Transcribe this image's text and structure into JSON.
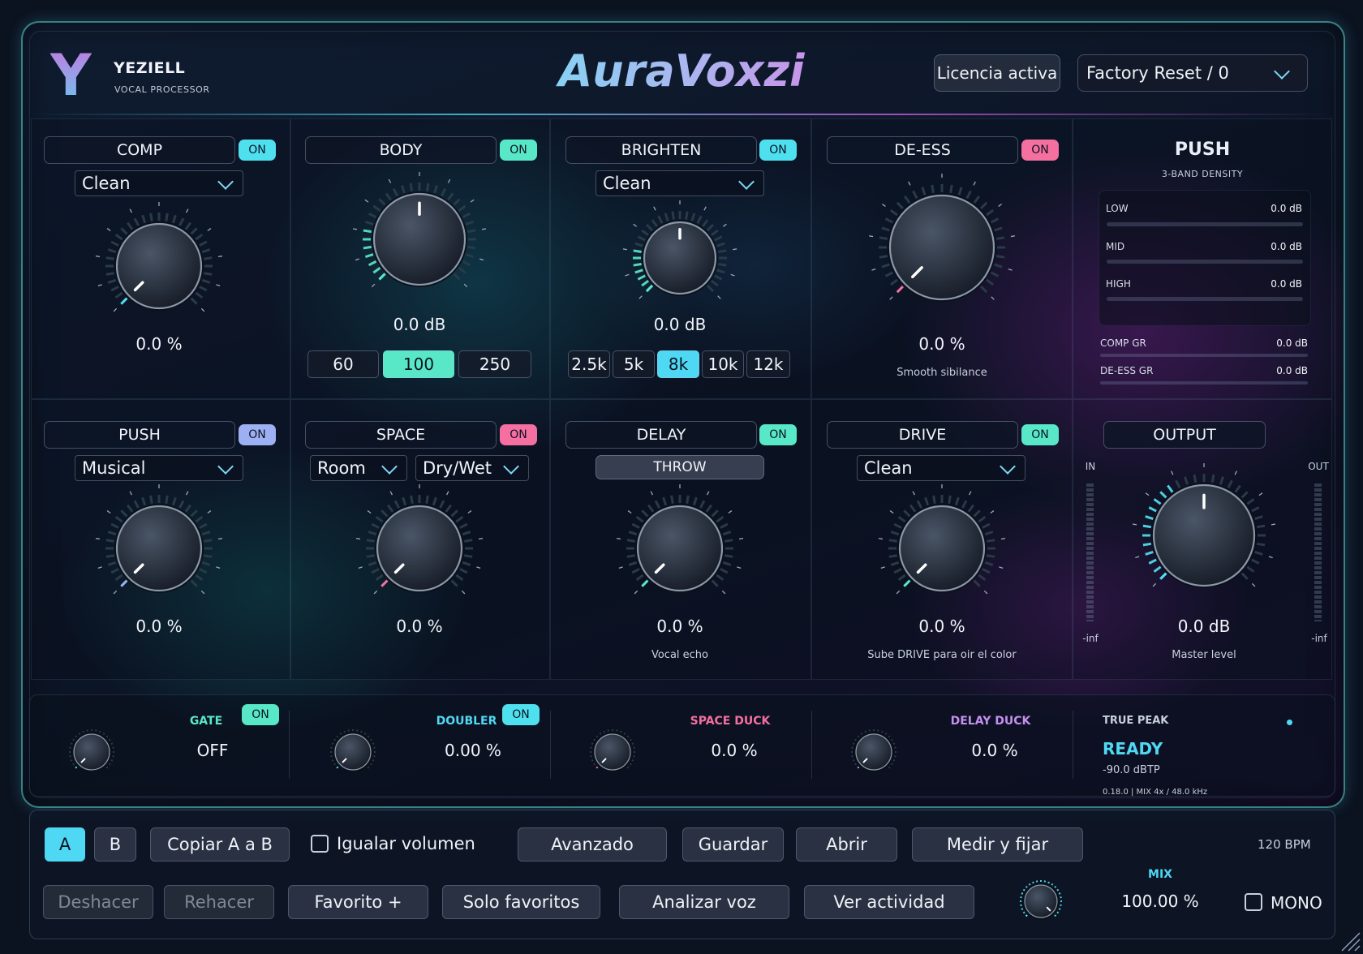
{
  "header": {
    "brand": "YEZIELL",
    "brand_sub": "VOCAL PROCESSOR",
    "title": "AuraVoxzi",
    "license": "Licencia activa",
    "preset": "Factory Reset / 0"
  },
  "comp": {
    "name": "COMP",
    "on": "ON",
    "mode": "Clean",
    "value": "0.0 %"
  },
  "body": {
    "name": "BODY",
    "on": "ON",
    "value": "0.0 dB",
    "freqs": [
      "60",
      "100",
      "250"
    ],
    "active": "100"
  },
  "brighten": {
    "name": "BRIGHTEN",
    "on": "ON",
    "mode": "Clean",
    "value": "0.0 dB",
    "freqs": [
      "2.5k",
      "5k",
      "8k",
      "10k",
      "12k"
    ],
    "active": "8k"
  },
  "deess": {
    "name": "DE-ESS",
    "on": "ON",
    "value": "0.0 %",
    "caption": "Smooth sibilance"
  },
  "push_meter": {
    "title": "PUSH",
    "subtitle": "3-BAND DENSITY",
    "bands": [
      {
        "label": "LOW",
        "value": "0.0 dB"
      },
      {
        "label": "MID",
        "value": "0.0 dB"
      },
      {
        "label": "HIGH",
        "value": "0.0 dB"
      }
    ],
    "gr": [
      {
        "label": "COMP GR",
        "value": "0.0 dB"
      },
      {
        "label": "DE-ESS GR",
        "value": "0.0 dB"
      }
    ]
  },
  "push": {
    "name": "PUSH",
    "on": "ON",
    "mode": "Musical",
    "value": "0.0 %"
  },
  "space": {
    "name": "SPACE",
    "on": "ON",
    "mode": "Room",
    "mode2": "Dry/Wet",
    "value": "0.0 %"
  },
  "delay": {
    "name": "DELAY",
    "on": "ON",
    "throw": "THROW",
    "value": "0.0 %",
    "caption": "Vocal echo"
  },
  "drive": {
    "name": "DRIVE",
    "on": "ON",
    "mode": "Clean",
    "value": "0.0 %",
    "caption": "Sube DRIVE para oir el color"
  },
  "output": {
    "name": "OUTPUT",
    "in": "IN",
    "out": "OUT",
    "in_min": "-inf",
    "out_min": "-inf",
    "value": "0.0 dB",
    "caption": "Master level"
  },
  "bottom": {
    "gate": {
      "label": "GATE",
      "on": "ON",
      "value": "OFF"
    },
    "doubler": {
      "label": "DOUBLER",
      "on": "ON",
      "value": "0.00 %"
    },
    "space_duck": {
      "label": "SPACE DUCK",
      "value": "0.0 %"
    },
    "delay_duck": {
      "label": "DELAY DUCK",
      "value": "0.0 %"
    },
    "true_peak": {
      "label": "TRUE PEAK",
      "status": "READY",
      "value": "-90.0 dBTP",
      "info": "0.18.0 | MIX 4x / 48.0 kHz"
    }
  },
  "toolbar": {
    "a": "A",
    "b": "B",
    "copy": "Copiar A a B",
    "match": "Igualar volumen",
    "advanced": "Avanzado",
    "save": "Guardar",
    "open": "Abrir",
    "measure": "Medir y fijar",
    "bpm": "120 BPM",
    "undo": "Deshacer",
    "redo": "Rehacer",
    "fav": "Favorito +",
    "solo_fav": "Solo favoritos",
    "analyze": "Analizar voz",
    "activity": "Ver actividad",
    "mix_label": "MIX",
    "mix_value": "100.00 %",
    "mono": "MONO"
  },
  "colors": {
    "cyan": "#4fe0f0",
    "teal": "#58e8c8",
    "pink": "#f56fa0",
    "lavender": "#9eb0f4",
    "purple": "#c45ae0"
  }
}
